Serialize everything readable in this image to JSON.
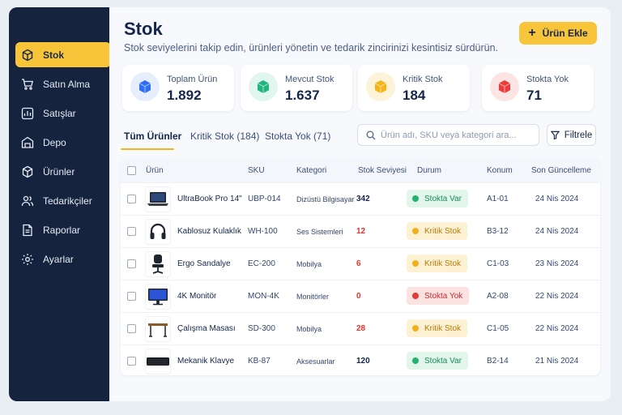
{
  "sidebar": {
    "items": [
      {
        "label": "Stok",
        "icon": "box-icon",
        "active": true
      },
      {
        "label": "Satın Alma",
        "icon": "cart-icon"
      },
      {
        "label": "Satışlar",
        "icon": "chart-icon"
      },
      {
        "label": "Depo",
        "icon": "warehouse-icon"
      },
      {
        "label": "Ürünler",
        "icon": "cube-icon"
      },
      {
        "label": "Tedarikçiler",
        "icon": "users-icon"
      },
      {
        "label": "Raporlar",
        "icon": "report-icon"
      },
      {
        "label": "Ayarlar",
        "icon": "gear-icon"
      }
    ]
  },
  "header": {
    "title": "Stok",
    "subtitle": "Stok seviyelerini takip edin, ürünleri yönetin ve tedarik zincirinizi kesintisiz sürdürün.",
    "add_button": "Ürün Ekle"
  },
  "stats": [
    {
      "label": "Toplam Ürün",
      "value": "1.892",
      "color": "#2f6df5",
      "bg": "#e6eefe"
    },
    {
      "label": "Mevcut Stok",
      "value": "1.637",
      "color": "#1fb57f",
      "bg": "#e1f6ee"
    },
    {
      "label": "Kritik Stok",
      "value": "184",
      "color": "#f5b417",
      "bg": "#fdf3d9"
    },
    {
      "label": "Stokta Yok",
      "value": "71",
      "color": "#ec3b3b",
      "bg": "#fde4e4"
    }
  ],
  "tabs": [
    {
      "label": "Tüm Ürünler",
      "active": true
    },
    {
      "label": "Kritik Stok (184)"
    },
    {
      "label": "Stokta Yok (71)"
    }
  ],
  "search": {
    "placeholder": "Ürün adı, SKU veya kategori ara..."
  },
  "filter_label": "Filtrele",
  "table": {
    "columns": [
      "Ürün",
      "SKU",
      "Kategori",
      "Stok Seviyesi",
      "Durum",
      "Konum",
      "Son Güncelleme"
    ],
    "rows": [
      {
        "name": "UltraBook Pro 14\"",
        "sku": "UBP-014",
        "category": "Dizüstü Bilgisayar",
        "stock": "342",
        "status": "Stokta Var",
        "location": "A1-01",
        "updated": "24 Nis 2024",
        "image": "laptop"
      },
      {
        "name": "Kablosuz Kulaklık",
        "sku": "WH-100",
        "category": "Ses Sistemleri",
        "stock": "12",
        "status": "Kritik Stok",
        "location": "B3-12",
        "updated": "24 Nis 2024",
        "image": "headphones"
      },
      {
        "name": "Ergo Sandalye",
        "sku": "EC-200",
        "category": "Mobilya",
        "stock": "6",
        "status": "Kritik Stok",
        "location": "C1-03",
        "updated": "23 Nis 2024",
        "image": "chair"
      },
      {
        "name": "4K Monitör",
        "sku": "MON-4K",
        "category": "Monitörler",
        "stock": "0",
        "status": "Stokta Yok",
        "location": "A2-08",
        "updated": "22 Nis 2024",
        "image": "monitor"
      },
      {
        "name": "Çalışma Masası",
        "sku": "SD-300",
        "category": "Mobilya",
        "stock": "28",
        "status": "Kritik Stok",
        "location": "C1-05",
        "updated": "22 Nis 2024",
        "image": "desk"
      },
      {
        "name": "Mekanik Klavye",
        "sku": "KB-87",
        "category": "Aksesuarlar",
        "stock": "120",
        "status": "Stokta Var",
        "location": "B2-14",
        "updated": "21 Nis 2024",
        "image": "keyboard"
      }
    ]
  },
  "status_styles": {
    "Stokta Var": {
      "bg": "#e3f6ec",
      "fg": "#188a5a",
      "dot": "#22b36c",
      "stock": "#14264b"
    },
    "Kritik Stok": {
      "bg": "#fdf1d4",
      "fg": "#b77c07",
      "dot": "#f2b11a",
      "stock": "#e4332f"
    },
    "Stokta Yok": {
      "bg": "#fde2e2",
      "fg": "#c62b2b",
      "dot": "#e53a3a",
      "stock": "#e4332f"
    }
  },
  "colors": {
    "accent": "#f8c53a",
    "sidebar_bg": "#15233f"
  }
}
